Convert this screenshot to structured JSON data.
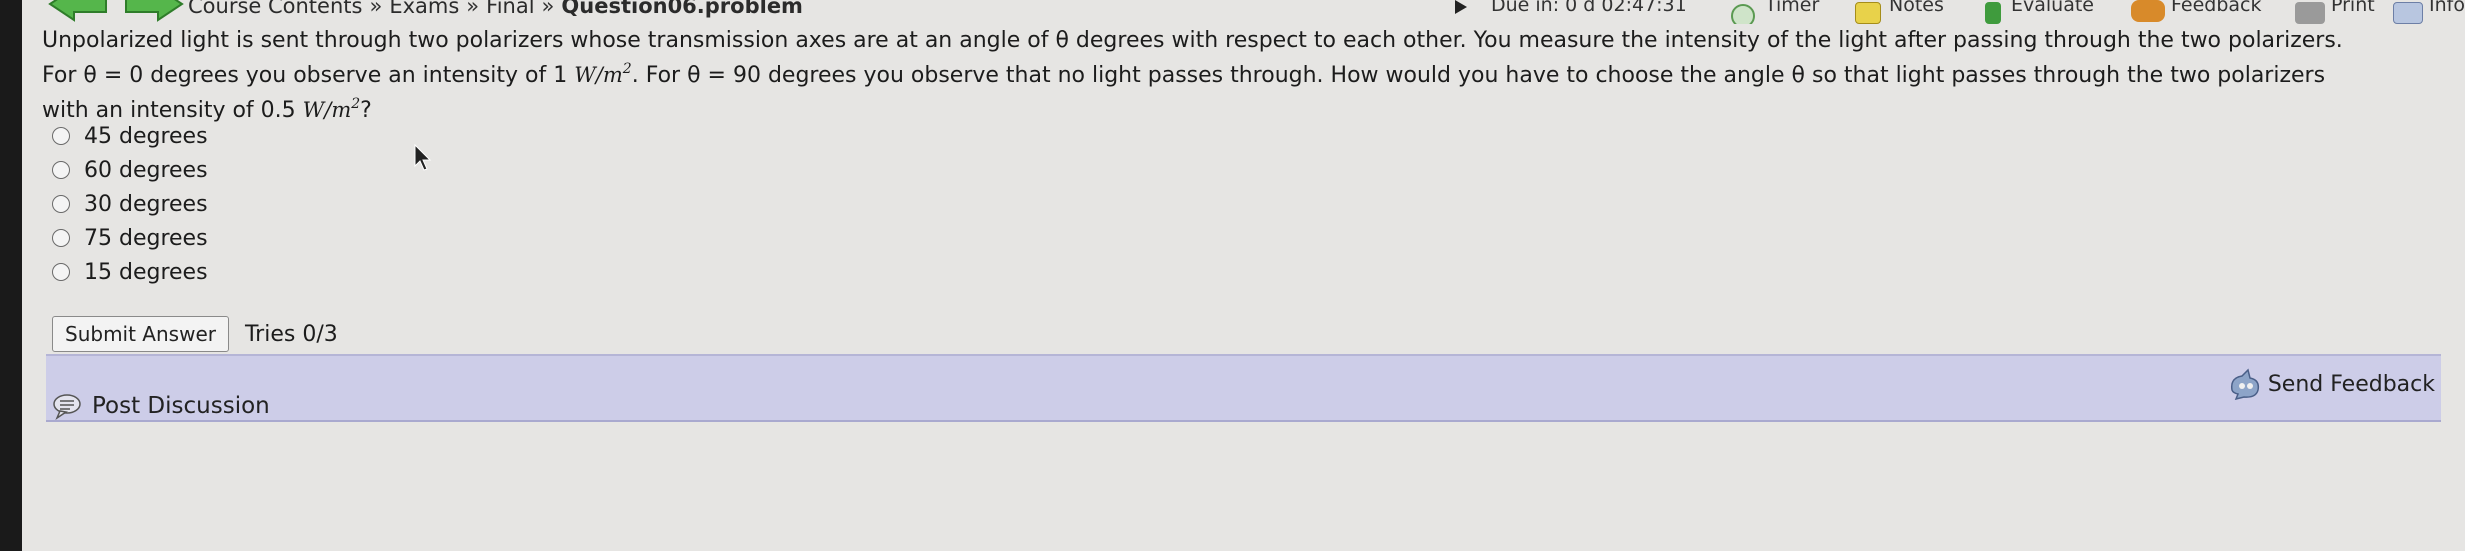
{
  "nav": {
    "breadcrumb": [
      {
        "label": "Course Contents"
      },
      {
        "label": "Exams"
      },
      {
        "label": "Final"
      }
    ],
    "separator": "»",
    "current": "Question06.problem",
    "due_label": "Due in: 0 d 02:47:31",
    "timer_label": "Timer",
    "notes_label": "Notes",
    "evaluate_label": "Evaluate",
    "feedback_label": "Feedback",
    "print_label": "Print",
    "info_label": "Info"
  },
  "problem": {
    "line1": "Unpolarized light is sent through two polarizers whose transmission axes are at an angle of θ degrees with respect to each other. You measure the intensity of the light after passing through the two polarizers.",
    "line2_a": "For θ = 0 degrees you observe an intensity of 1",
    "unit": "W/m",
    "exponent": "2",
    "line2_b": ". For θ = 90 degrees you observe that no light passes through. How would you have to choose the angle θ so that light passes through the two polarizers",
    "line3_a": "with an intensity of 0.5",
    "line3_b": "?"
  },
  "options": [
    {
      "label": "45 degrees"
    },
    {
      "label": "60 degrees"
    },
    {
      "label": "30 degrees"
    },
    {
      "label": "75 degrees"
    },
    {
      "label": "15 degrees"
    }
  ],
  "submit": {
    "label": "Submit Answer",
    "tries": "Tries 0/3"
  },
  "discussion": {
    "post_label": "Post Discussion",
    "feedback_label": "Send Feedback"
  },
  "colors": {
    "background": "#e6e5e3",
    "discussion_bar": "#cdcde8",
    "nav_arrow": "#55b64b"
  }
}
